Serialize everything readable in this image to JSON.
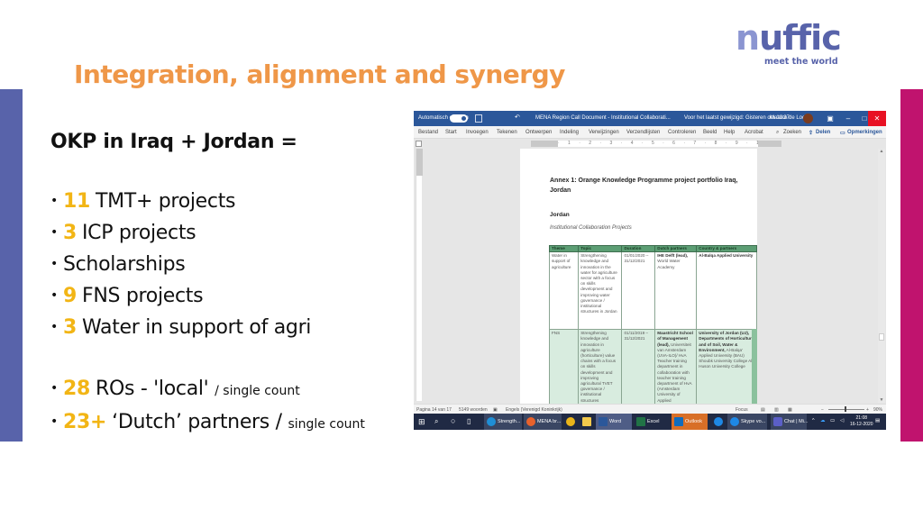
{
  "brand": {
    "logo_text": "nuffic",
    "tagline": "meet the world",
    "colors": {
      "title_orange": "#ef9748",
      "highlight_yellow": "#f2b515",
      "brand_blue": "#5863aa",
      "brand_magenta": "#c0136e"
    }
  },
  "slide": {
    "title": "Integration, alignment and synergy",
    "heading": "OKP in Iraq + Jordan =",
    "bullets": [
      {
        "num": "11",
        "text": "TMT+ projects",
        "note": ""
      },
      {
        "num": "3",
        "text": "ICP projects",
        "note": ""
      },
      {
        "num": "",
        "text": "Scholarships",
        "note": ""
      },
      {
        "num": "9",
        "text": "FNS projects",
        "note": ""
      },
      {
        "num": "3",
        "text": "Water in support of agri",
        "note": ""
      }
    ],
    "bullets2": [
      {
        "num": "28",
        "text": "ROs - 'local'",
        "note": "/ single count"
      },
      {
        "num": "23+",
        "text": "‘Dutch’ partners /",
        "note": "single count"
      }
    ],
    "bullet_glyph": "•"
  },
  "word_window": {
    "autosave_label": "Automatisch opslaan",
    "doc_title": "MENA Region Call Document - Institutional Collaborati...",
    "saved_status": "Voor het laatst gewijzigd: Gisteren om 11:37",
    "user_name": "Maaike de Loor",
    "window_buttons": {
      "restore_ribbon": "▣",
      "minimize": "–",
      "maximize": "□",
      "close": "✕"
    },
    "ribbon_tabs": [
      "Bestand",
      "Start",
      "Invoegen",
      "Tekenen",
      "Ontwerpen",
      "Indeling",
      "Verwijzingen",
      "Verzendlijsten",
      "Controleren",
      "Beeld",
      "Help",
      "Acrobat"
    ],
    "search_label": "Zoeken",
    "share_label": "Delen",
    "comments_label": "Opmerkingen",
    "ruler_text": "· 1 · 2 · 3 · 4 · 5 · 6 · 7 · 8 · 9 · 10 · 11 · 12 · 13 · 14 · 15",
    "document": {
      "annex_title": "Annex 1: Orange Knowledge Programme project portfolio Iraq, Jordan",
      "country": "Jordan",
      "subtitle": "Institutional Collaboration Projects",
      "table": {
        "headers": [
          "Theme",
          "Topic",
          "Duration",
          "Dutch partners",
          "Country & partners"
        ],
        "rows": [
          {
            "theme": "Water in support of agriculture",
            "topic": "Strengthening knowledge and innovation in the water for agriculture sector with a focus on skills development and improving water governance / institutional structures in Jordan",
            "duration": "01/01/2020 – 31/12/2021",
            "dutch_lead": "IHE Delft (lead),",
            "dutch_rest": "World Water Academy",
            "country_lead": "Al-Balqa Applied University",
            "country_rest": ""
          },
          {
            "theme": "FNS",
            "topic": "Strengthening knowledge and innovation in agriculture (horticulture) value chains with a focus on skills development and improving agricultural TVET governance / institutional structures",
            "duration": "01/11/2019 – 31/12/2021",
            "dutch_lead": "Maastricht School of Management (lead),",
            "dutch_rest": "Universiteit van Amsterdam (UVA-ILO)/ HvA Teacher training department in collaboration with teacher training department of HvA (Amsterdam University of Applied",
            "country_lead": "University of Jordan (UJ), Departments of Horticulture and of Soil, Water & Environment,",
            "country_rest": "Al-Balqa' Applied University (BAU) Shoubk University College Al-Huson University College"
          }
        ]
      }
    },
    "statusbar": {
      "page": "Pagina 14 van 17",
      "words": "5149 woorden",
      "language": "Engels (Verenigd Koninkrijk)",
      "focus": "Focus",
      "zoom": "90%"
    },
    "taskbar": {
      "apps": [
        {
          "label": "Strength...",
          "color": "#1f8fd6"
        },
        {
          "label": "MENA br...",
          "color": "#e8622c"
        },
        {
          "label": "",
          "color": "#e9b41a"
        },
        {
          "label": "",
          "color": "#f2c94c"
        },
        {
          "label": "Word",
          "color": "#2b579a"
        },
        {
          "label": "Excel",
          "color": "#217346"
        },
        {
          "label": "Outlook",
          "color": "#0f6cbd"
        },
        {
          "label": "S",
          "color": "#1e88e5"
        },
        {
          "label": "Skype vo...",
          "color": "#1e88e5"
        },
        {
          "label": "Chat | Mi...",
          "color": "#5b5fc7"
        }
      ],
      "time": "21:08",
      "date": "16-12-2020"
    }
  }
}
